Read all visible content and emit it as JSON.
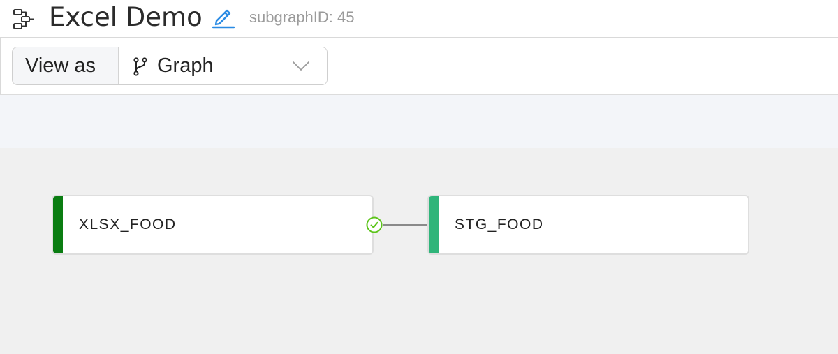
{
  "header": {
    "title": "Excel Demo",
    "subgraph_id": "subgraphID: 45",
    "icons": {
      "subgraph": "subgraph-icon",
      "edit": "pencil-edit-icon"
    }
  },
  "toolbar": {
    "view_as_label": "View as",
    "view_select": {
      "value": "Graph",
      "icon": "branch-icon",
      "chevron": "chevron-down-icon"
    }
  },
  "canvas": {
    "nodes": [
      {
        "label": "XLSX_FOOD",
        "accent_color": "#0a7d12"
      },
      {
        "label": "STG_FOOD",
        "accent_color": "#2fb57a"
      }
    ],
    "edge": {
      "status": "success",
      "status_color": "#5cc41a"
    }
  },
  "colors": {
    "edit_icon": "#2a8be4",
    "band": "#f3f5f9",
    "canvas_bg": "#f0f0f0"
  }
}
